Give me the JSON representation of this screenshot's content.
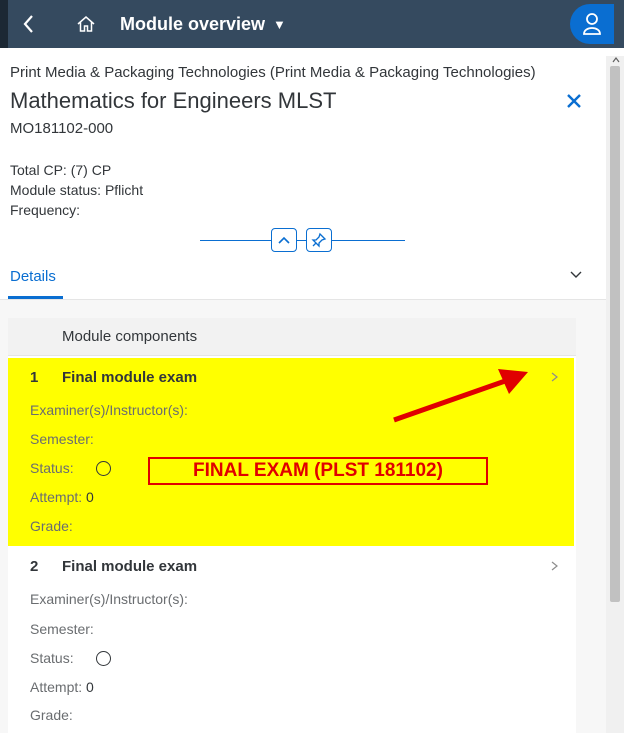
{
  "shellbar": {
    "title": "Module overview",
    "caret": "▼",
    "icons": [
      "back-icon",
      "home-icon",
      "user-icon"
    ]
  },
  "header": {
    "breadcrumb": "Print Media & Packaging Technologies (Print Media & Packaging Technologies)",
    "title": "Mathematics for Engineers MLST",
    "code": "MO181102-000",
    "total_cp_label": "Total CP:",
    "total_cp_value": "(7) CP",
    "status_label": "Module status:",
    "status_value": "Pflicht",
    "frequency_label": "Frequency:",
    "frequency_value": ""
  },
  "tabs": {
    "details_label": "Details"
  },
  "components": {
    "header_label": "Module components",
    "items": [
      {
        "number": "1",
        "title": "Final module exam",
        "examiner_label": "Examiner(s)/Instructor(s):",
        "semester_label": "Semester:",
        "status_label": "Status:",
        "attempt_label": "Attempt:",
        "attempt_value": "0",
        "grade_label": "Grade:",
        "highlight_color": "#ffff00"
      },
      {
        "number": "2",
        "title": "Final module exam",
        "examiner_label": "Examiner(s)/Instructor(s):",
        "semester_label": "Semester:",
        "status_label": "Status:",
        "attempt_label": "Attempt:",
        "attempt_value": "0",
        "grade_label": "Grade:"
      }
    ]
  },
  "annotation": {
    "text": "FINAL EXAM (PLST 181102)",
    "color": "#e00000"
  },
  "colors": {
    "shellbar": "#354a5f",
    "accent": "#0a6ed1"
  }
}
